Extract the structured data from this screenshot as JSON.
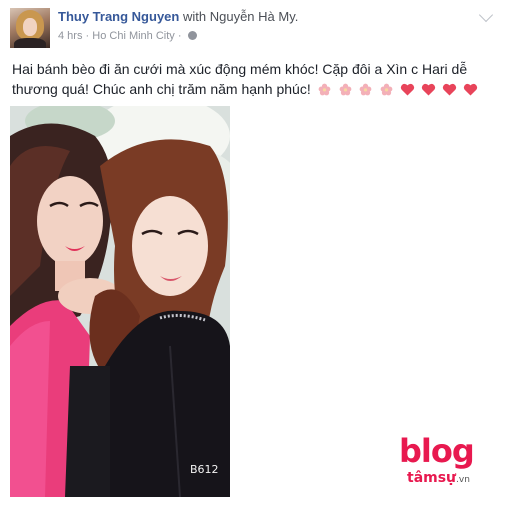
{
  "post": {
    "author": "Thuy Trang Nguyen",
    "with_word": "with",
    "tagged": "Nguyễn Hà My.",
    "time": "4 hrs",
    "separator": "·",
    "location": "Ho Chi Minh City",
    "separator2": "·",
    "text": "Hai bánh bèo đi ăn cưới mà xúc động mém khóc! Cặp đôi a Xìn c Hari dễ thương quá! Chúc anh chị trăm năm hạnh phúc!",
    "emoji": [
      "blossom-icon",
      "blossom-icon",
      "blossom-icon",
      "blossom-icon",
      "heart-icon",
      "heart-icon",
      "heart-icon",
      "heart-icon"
    ]
  },
  "photo": {
    "stamp": "B612"
  },
  "watermark": {
    "main": "blog",
    "sub": "tâmsự",
    "suffix": ".vn"
  },
  "colors": {
    "link": "#365899",
    "heart": "#e8445a",
    "blossom": "#f3b0b8",
    "logo": "#e8194f"
  }
}
